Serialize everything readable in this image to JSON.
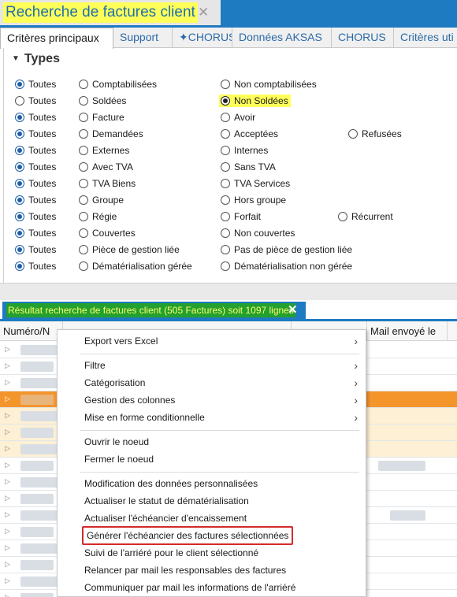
{
  "window": {
    "title": "Recherche de factures client"
  },
  "criteria_tabs": [
    {
      "label": "Critères principaux",
      "active": true
    },
    {
      "label": "Support",
      "active": false
    },
    {
      "label": "✦CHORUS",
      "active": false
    },
    {
      "label": "Données AKSAS",
      "active": false
    },
    {
      "label": "CHORUS",
      "active": false
    },
    {
      "label": "Critères uti",
      "active": false
    }
  ],
  "types_section": {
    "title": "Types",
    "rows": [
      {
        "all": "Toutes",
        "options": [
          "Comptabilisées",
          "Non comptabilisées"
        ],
        "selected": "Toutes"
      },
      {
        "all": "Toutes",
        "options": [
          "Soldées",
          "Non Soldées"
        ],
        "selected": "Non Soldées"
      },
      {
        "all": "Toutes",
        "options": [
          "Facture",
          "Avoir"
        ],
        "selected": "Toutes"
      },
      {
        "all": "Toutes",
        "options": [
          "Demandées",
          "Acceptées",
          "Refusées"
        ],
        "selected": "Toutes"
      },
      {
        "all": "Toutes",
        "options": [
          "Externes",
          "Internes"
        ],
        "selected": "Toutes"
      },
      {
        "all": "Toutes",
        "options": [
          "Avec TVA",
          "Sans TVA"
        ],
        "selected": "Toutes"
      },
      {
        "all": "Toutes",
        "options": [
          "TVA Biens",
          "TVA Services"
        ],
        "selected": "Toutes"
      },
      {
        "all": "Toutes",
        "options": [
          "Groupe",
          "Hors groupe"
        ],
        "selected": "Toutes"
      },
      {
        "all": "Toutes",
        "options": [
          "Régie",
          "Forfait",
          "Récurrent"
        ],
        "selected": "Toutes"
      },
      {
        "all": "Toutes",
        "options": [
          "Couvertes",
          "Non couvertes"
        ],
        "selected": "Toutes"
      },
      {
        "all": "Toutes",
        "options": [
          "Pièce de gestion liée",
          "Pas de pièce de gestion liée"
        ],
        "selected": "Toutes"
      },
      {
        "all": "Toutes",
        "options": [
          "Dématérialisation gérée",
          "Dématérialisation non gérée"
        ],
        "selected": "Toutes"
      }
    ]
  },
  "results": {
    "tab_title": "Résultat recherche de factures client (505 Factures) soit 1097 lignes",
    "columns": [
      "Numéro/N",
      "Mail envoyé le"
    ]
  },
  "context_menu": {
    "groups": [
      [
        {
          "label": "Export vers Excel",
          "submenu": true
        }
      ],
      [
        {
          "label": "Filtre",
          "submenu": true
        },
        {
          "label": "Catégorisation",
          "submenu": true
        },
        {
          "label": "Gestion des colonnes",
          "submenu": true
        },
        {
          "label": "Mise en forme conditionnelle",
          "submenu": true
        }
      ],
      [
        {
          "label": "Ouvrir le noeud",
          "submenu": false
        },
        {
          "label": "Fermer le noeud",
          "submenu": false
        }
      ],
      [
        {
          "label": "Modification des données personnalisées",
          "submenu": false
        },
        {
          "label": "Actualiser le statut de dématérialisation",
          "submenu": false
        },
        {
          "label": "Actualiser l'échéancier d'encaissement",
          "submenu": false
        },
        {
          "label": "Générer l'échéancier des factures sélectionnées",
          "submenu": false,
          "highlighted": true
        },
        {
          "label": "Suivi de l'arriéré pour le client sélectionné",
          "submenu": false
        },
        {
          "label": "Relancer par mail les responsables des factures",
          "submenu": false
        },
        {
          "label": "Communiquer par mail les informations de l'arriéré",
          "submenu": false
        }
      ]
    ]
  },
  "colors": {
    "accent": "#1e7bc2",
    "highlight": "#ffff5a",
    "result_tab_bg": "#23a02f",
    "selected_row": "#f4952c",
    "menu_highlight_border": "#d42a2a"
  },
  "icons": {
    "collapse": "triangle-down",
    "close": "x",
    "submenu": "chevron-right",
    "row_expand": "triangle-right"
  }
}
